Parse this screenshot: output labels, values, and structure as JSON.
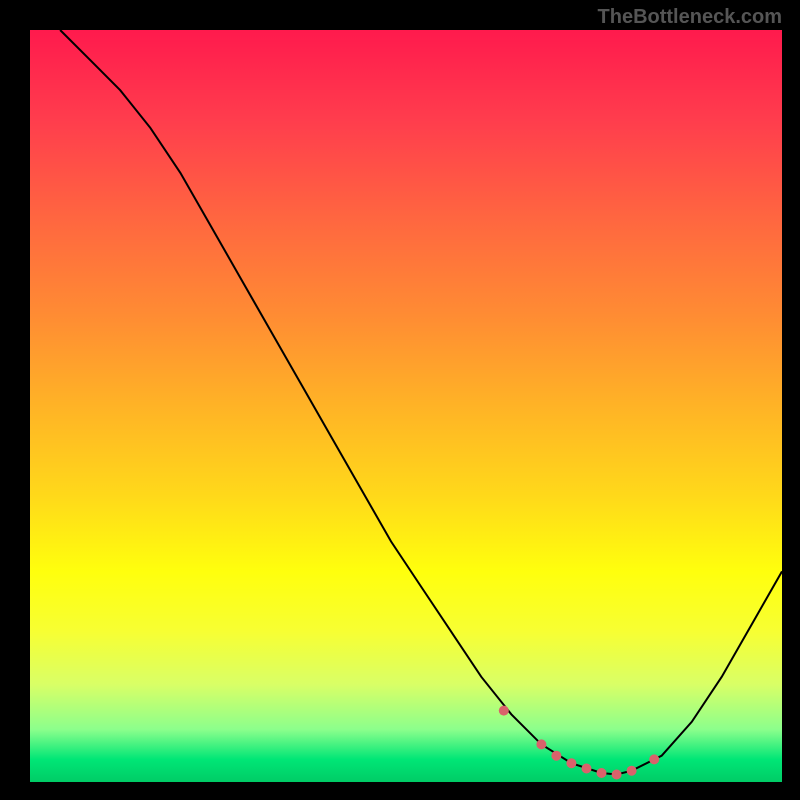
{
  "watermark": "TheBottleneck.com",
  "chart_data": {
    "type": "line",
    "title": "",
    "xlabel": "",
    "ylabel": "",
    "xlim": [
      0,
      100
    ],
    "ylim": [
      0,
      100
    ],
    "series": [
      {
        "name": "bottleneck-curve",
        "x": [
          4,
          8,
          12,
          16,
          20,
          24,
          28,
          32,
          36,
          40,
          44,
          48,
          52,
          56,
          60,
          64,
          68,
          72,
          76,
          78,
          80,
          84,
          88,
          92,
          96,
          100
        ],
        "values": [
          100,
          96,
          92,
          87,
          81,
          74,
          67,
          60,
          53,
          46,
          39,
          32,
          26,
          20,
          14,
          9.0,
          5.0,
          2.5,
          1.2,
          1.0,
          1.5,
          3.5,
          8.0,
          14,
          21,
          28
        ]
      }
    ],
    "markers": {
      "name": "highlight-dots",
      "color": "#d9626b",
      "x": [
        63,
        68,
        70,
        72,
        74,
        76,
        78,
        80,
        83
      ],
      "values": [
        9.5,
        5.0,
        3.5,
        2.5,
        1.8,
        1.2,
        1.0,
        1.5,
        3.0
      ]
    }
  }
}
